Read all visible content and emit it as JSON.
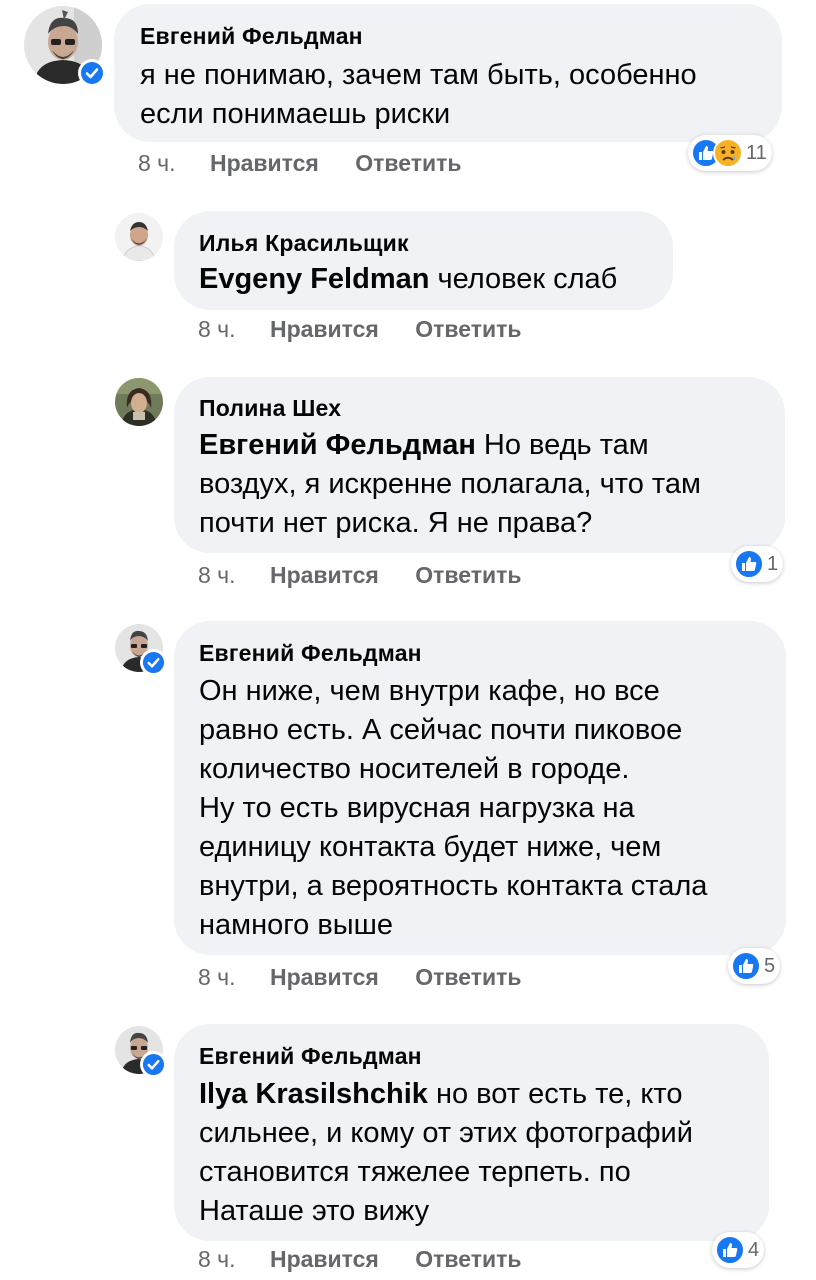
{
  "meta_labels": {
    "like": "Нравится",
    "reply": "Ответить"
  },
  "colors": {
    "bubble": "#f0f2f5",
    "like_blue": "#1877f2",
    "meta_gray": "#65676b",
    "sad_yellow": "#f7b125"
  },
  "comments": [
    {
      "author": "Евгений Фельдман",
      "verified": true,
      "mention": "",
      "text": "я не понимаю, зачем там быть, особенно\nесли понимаешь риски",
      "time": "8 ч.",
      "reactions": [
        "like-icon",
        "sad-icon"
      ],
      "reaction_count": "11"
    },
    {
      "author": "Илья Красильщик",
      "verified": false,
      "mention": "Evgeny Feldman",
      "text": " человек слаб",
      "time": "8 ч.",
      "reactions": [],
      "reaction_count": ""
    },
    {
      "author": "Полина Шех",
      "verified": false,
      "mention": "Евгений Фельдман",
      "text": " Но ведь там\nвоздух, я искренне полагала, что там\nпочти нет риска. Я не права?",
      "time": "8 ч.",
      "reactions": [
        "like-icon"
      ],
      "reaction_count": "1"
    },
    {
      "author": "Евгений Фельдман",
      "verified": true,
      "mention": "",
      "text": "Он ниже, чем внутри кафе, но все\nравно есть. А сейчас почти пиковое\nколичество носителей в городе.\nНу то есть вирусная нагрузка на\nединицу контакта будет ниже, чем\nвнутри, а вероятность контакта стала\nнамного выше",
      "time": "8 ч.",
      "reactions": [
        "like-icon"
      ],
      "reaction_count": "5"
    },
    {
      "author": "Евгений Фельдман",
      "verified": true,
      "mention": "Ilya Krasilshchik",
      "text": " но вот есть те, кто\nсильнее, и кому от этих фотографий\nстановится тяжелее терпеть. по\nНаташе это вижу",
      "time": "8 ч.",
      "reactions": [
        "like-icon"
      ],
      "reaction_count": "4"
    }
  ]
}
